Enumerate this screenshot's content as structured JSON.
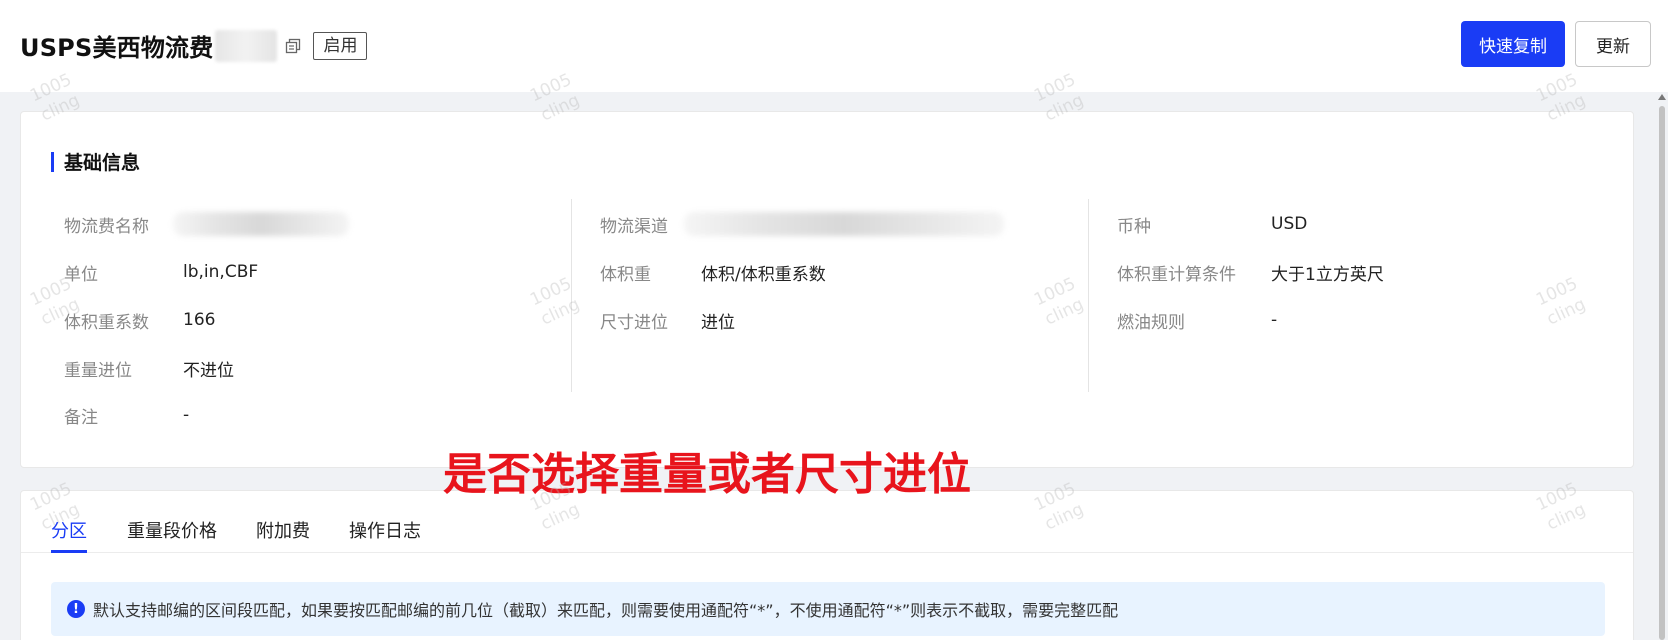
{
  "header": {
    "title": "USPS美西物流费",
    "status_tag": "启用",
    "quick_copy_label": "快速复制",
    "update_label": "更新"
  },
  "basic_info": {
    "section_title": "基础信息",
    "col1": [
      {
        "label": "物流费名称",
        "value": ""
      },
      {
        "label": "单位",
        "value": "lb,in,CBF"
      },
      {
        "label": "体积重系数",
        "value": "166"
      },
      {
        "label": "重量进位",
        "value": "不进位"
      },
      {
        "label": "备注",
        "value": "-"
      }
    ],
    "col2": [
      {
        "label": "物流渠道",
        "value": ""
      },
      {
        "label": "体积重",
        "value": "体积/体积重系数"
      },
      {
        "label": "尺寸进位",
        "value": "进位"
      }
    ],
    "col3": [
      {
        "label": "币种",
        "value": "USD"
      },
      {
        "label": "体积重计算条件",
        "value": "大于1立方英尺"
      },
      {
        "label": "燃油规则",
        "value": "-"
      }
    ]
  },
  "annotation": "是否选择重量或者尺寸进位",
  "tabs": [
    {
      "label": "分区",
      "active": true
    },
    {
      "label": "重量段价格",
      "active": false
    },
    {
      "label": "附加费",
      "active": false
    },
    {
      "label": "操作日志",
      "active": false
    }
  ],
  "alert": {
    "icon": "info-circle-icon",
    "text": "默认支持邮编的区间段匹配，如果要按匹配邮编的前几位（截取）来匹配，则需要使用通配符“*”，不使用通配符“*”则表示不截取，需要完整匹配"
  },
  "watermark": {
    "line1": "1005",
    "line2": "cling"
  },
  "colors": {
    "accent": "#1a3cf5",
    "annotation": "#e8141c",
    "alert_bg": "#e8f3ff"
  }
}
